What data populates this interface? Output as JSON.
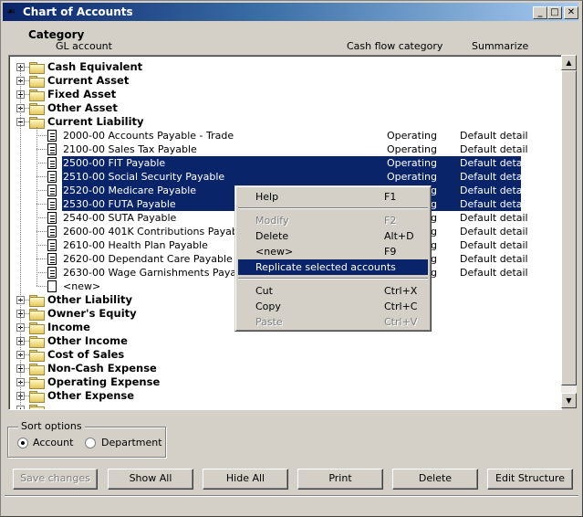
{
  "window": {
    "title": "Chart of Accounts",
    "icon": "app-icon",
    "controls": {
      "minimize": "_",
      "maximize": "□",
      "close": "X"
    }
  },
  "columns": {
    "category": "Category",
    "gl_account": "GL account",
    "cash_flow": "Cash flow category",
    "summarize": "Summarize"
  },
  "tree": {
    "categories_top": [
      {
        "label": "Cash Equivalent",
        "expanded": false
      },
      {
        "label": "Current Asset",
        "expanded": false
      },
      {
        "label": "Fixed Asset",
        "expanded": false
      },
      {
        "label": "Other Asset",
        "expanded": false
      },
      {
        "label": "Current Liability",
        "expanded": true
      }
    ],
    "accounts": [
      {
        "label": "2000-00 Accounts Payable - Trade",
        "cash_flow": "Operating",
        "summarize": "Default detail",
        "selected": false
      },
      {
        "label": "2100-00 Sales Tax Payable",
        "cash_flow": "Operating",
        "summarize": "Default detail",
        "selected": false
      },
      {
        "label": "2500-00 FIT Payable",
        "cash_flow": "Operating",
        "summarize": "Default detail",
        "selected": true
      },
      {
        "label": "2510-00 Social Security Payable",
        "cash_flow": "Operating",
        "summarize": "Default detail",
        "selected": true
      },
      {
        "label": "2520-00 Medicare Payable",
        "cash_flow": "Operating",
        "summarize": "Default detail",
        "selected": true
      },
      {
        "label": "2530-00 FUTA Payable",
        "cash_flow": "Operating",
        "summarize": "Default detail",
        "selected": true
      },
      {
        "label": "2540-00 SUTA Payable",
        "cash_flow": "Operating",
        "summarize": "Default detail",
        "selected": false
      },
      {
        "label": "2600-00 401K Contributions Payable",
        "cash_flow": "Operating",
        "summarize": "Default detail",
        "selected": false
      },
      {
        "label": "2610-00 Health Plan Payable",
        "cash_flow": "Operating",
        "summarize": "Default detail",
        "selected": false
      },
      {
        "label": "2620-00 Dependant Care Payable",
        "cash_flow": "Operating",
        "summarize": "Default detail",
        "selected": false
      },
      {
        "label": "2630-00 Wage Garnishments Payable",
        "cash_flow": "Operating",
        "summarize": "Default detail",
        "selected": false
      }
    ],
    "new_item": "<new>",
    "categories_bottom": [
      {
        "label": "Other Liability",
        "expanded": false
      },
      {
        "label": "Owner's Equity",
        "expanded": false
      },
      {
        "label": "Income",
        "expanded": false
      },
      {
        "label": "Other Income",
        "expanded": false
      },
      {
        "label": "Cost of Sales",
        "expanded": false
      },
      {
        "label": "Non-Cash Expense",
        "expanded": false
      },
      {
        "label": "Operating Expense",
        "expanded": false
      },
      {
        "label": "Other Expense",
        "expanded": false
      }
    ]
  },
  "context_menu": {
    "items": [
      {
        "label": "Help",
        "shortcut": "F1",
        "disabled": false,
        "highlighted": false
      },
      {
        "label": "Modify",
        "shortcut": "F2",
        "disabled": true,
        "highlighted": false
      },
      {
        "label": "Delete",
        "shortcut": "Alt+D",
        "disabled": false,
        "highlighted": false
      },
      {
        "label": "<new>",
        "shortcut": "F9",
        "disabled": false,
        "highlighted": false
      },
      {
        "label": "Replicate selected accounts",
        "shortcut": "",
        "disabled": false,
        "highlighted": true
      },
      {
        "label": "Cut",
        "shortcut": "Ctrl+X",
        "disabled": false,
        "highlighted": false
      },
      {
        "label": "Copy",
        "shortcut": "Ctrl+C",
        "disabled": false,
        "highlighted": false
      },
      {
        "label": "Paste",
        "shortcut": "Ctrl+V",
        "disabled": true,
        "highlighted": false
      }
    ]
  },
  "sort_options": {
    "title": "Sort options",
    "options": [
      {
        "label": "Account",
        "checked": true
      },
      {
        "label": "Department",
        "checked": false
      }
    ]
  },
  "buttons": {
    "save_changes": "Save changes",
    "show_all": "Show All",
    "hide_all": "Hide All",
    "print": "Print",
    "delete": "Delete",
    "edit_structure": "Edit Structure"
  },
  "colors": {
    "selection": "#0a246a",
    "title_start": "#0a246a",
    "title_end": "#a6caf0",
    "face": "#d4d0c8"
  }
}
